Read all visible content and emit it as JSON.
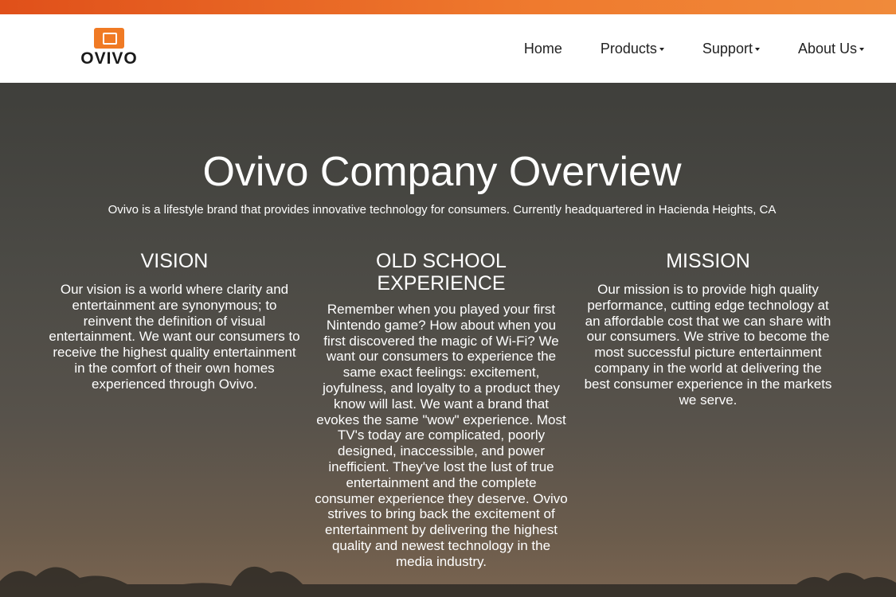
{
  "brand": {
    "name": "OVIVO"
  },
  "nav": {
    "items": [
      {
        "label": "Home",
        "dropdown": false
      },
      {
        "label": "Products",
        "dropdown": true
      },
      {
        "label": "Support",
        "dropdown": true
      },
      {
        "label": "About Us",
        "dropdown": true
      }
    ]
  },
  "hero": {
    "title": "Ovivo Company Overview",
    "subtitle": "Ovivo is a lifestyle brand that provides innovative technology for consumers. Currently headquartered in Hacienda Heights, CA"
  },
  "columns": [
    {
      "heading": "VISION",
      "body": "Our vision is a world where clarity and entertainment are synonymous; to reinvent the definition of visual entertainment. We want our consumers to receive the highest quality entertainment in the comfort of their own homes experienced through Ovivo."
    },
    {
      "heading": "OLD SCHOOL EXPERIENCE",
      "body": "Remember when you played your first Nintendo game? How about when you first discovered the magic of Wi-Fi? We want our consumers to experience the same exact feelings: excitement, joyfulness, and loyalty to a product they know will last. We want a brand that evokes the same \"wow\" experience. Most TV's today are complicated, poorly designed, inaccessible, and power inefficient. They've lost the lust of true entertainment and the complete consumer experience they deserve. Ovivo strives to bring back the excitement of entertainment by delivering the highest quality and newest technology in the media industry."
    },
    {
      "heading": "MISSION",
      "body": "Our mission is to provide high quality performance, cutting edge technology at an affordable cost that we can share with our consumers. We strive to become the most successful picture entertainment company in the world at delivering the best consumer experience in the markets we serve."
    }
  ],
  "colors": {
    "accent": "#f07a24",
    "header_bg": "#ffffff",
    "text_on_hero": "#ffffff"
  }
}
